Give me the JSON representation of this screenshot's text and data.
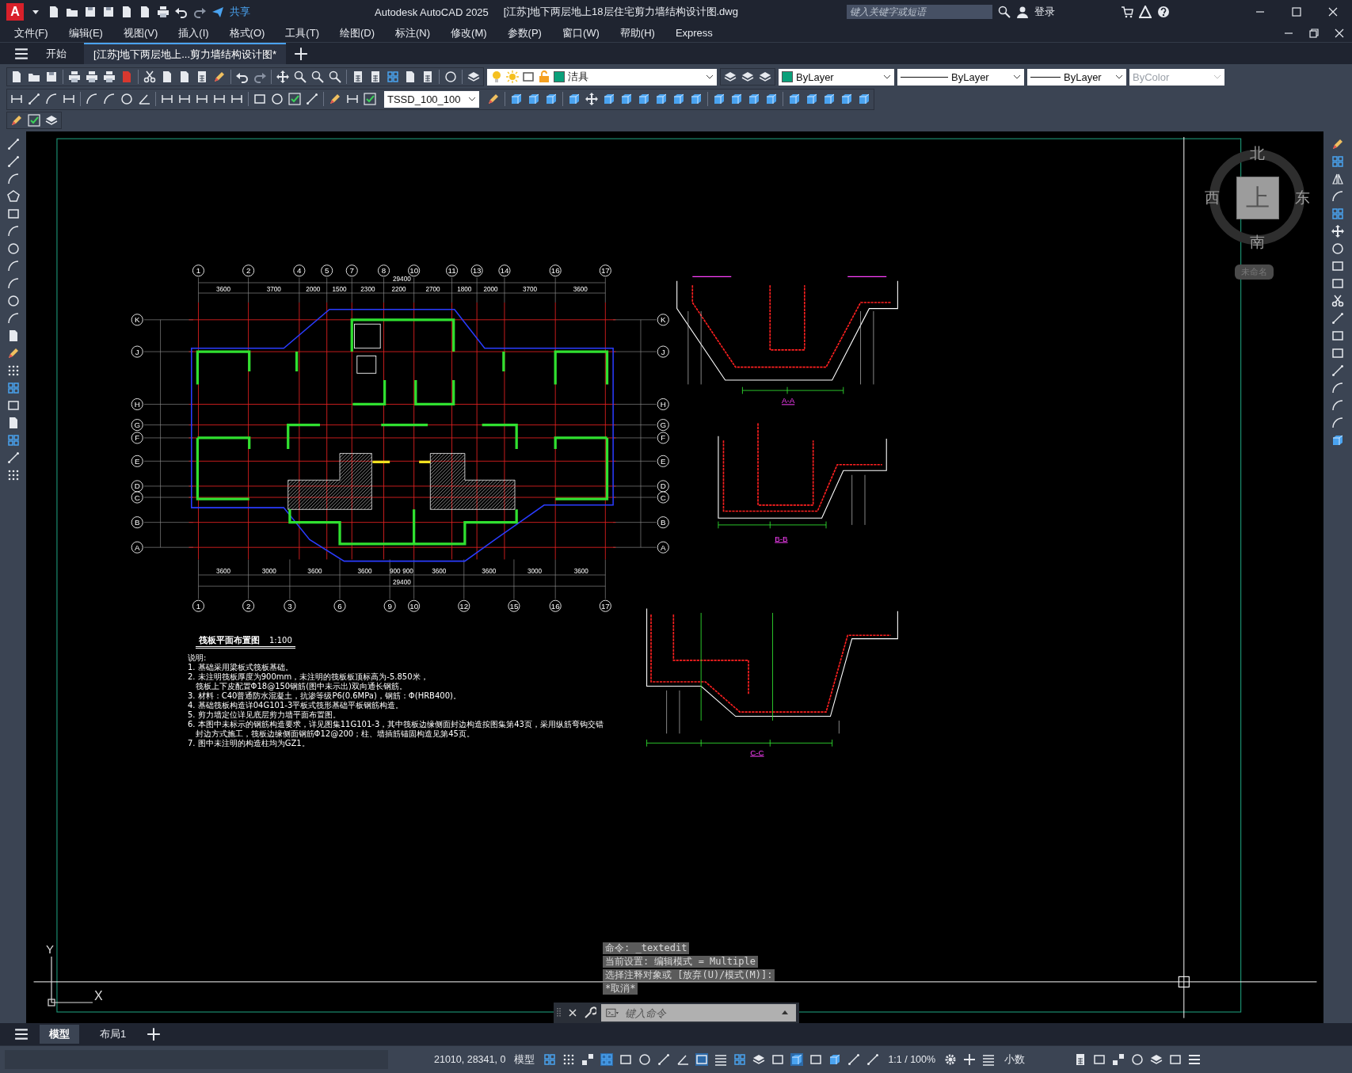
{
  "title_bar": {
    "logo": "A",
    "share": "共享",
    "app_title": "Autodesk AutoCAD 2025",
    "file_title": "[江苏]地下两层地上18层住宅剪力墙结构设计图.dwg",
    "search": {
      "placeholder": "键入关键字或短语"
    },
    "sign_in": "登录"
  },
  "menu": [
    "文件(F)",
    "编辑(E)",
    "视图(V)",
    "插入(I)",
    "格式(O)",
    "工具(T)",
    "绘图(D)",
    "标注(N)",
    "修改(M)",
    "参数(P)",
    "窗口(W)",
    "帮助(H)",
    "Express"
  ],
  "file_tabs": [
    {
      "label": "开始",
      "selected": false
    },
    {
      "label": "[江苏]地下两层地上...剪力墙结构设计图*",
      "selected": true
    }
  ],
  "properties_bar": {
    "layer": "洁具",
    "color_setting": "ByLayer",
    "linetype": "ByLayer",
    "lineweight": "ByLayer",
    "plot_style": {
      "label": "ByColor",
      "disabled": true
    }
  },
  "dim_style": "TSSD_100_100",
  "drawing": {
    "plan": {
      "top_axes": [
        "1",
        "2",
        "4",
        "5",
        "7",
        "8",
        "10",
        "11",
        "13",
        "14",
        "16",
        "17"
      ],
      "bottom_axes": [
        "1",
        "2",
        "3",
        "6",
        "9",
        "10",
        "12",
        "15",
        "16",
        "17"
      ],
      "left_axes": [
        "K",
        "J",
        "H",
        "G",
        "F",
        "E",
        "D",
        "C",
        "B",
        "A"
      ],
      "right_axes": [
        "K",
        "J",
        "H",
        "G",
        "F",
        "E",
        "D",
        "C",
        "B",
        "A"
      ],
      "top_dims": [
        "3600",
        "3700",
        "2000",
        "1500",
        "2300",
        "2200",
        "2700",
        "1800",
        "2000",
        "3700",
        "3600"
      ],
      "top_total": "29400",
      "bottom_dims": [
        "3600",
        "3000",
        "3600",
        "3600",
        "900",
        "900",
        "3600",
        "3600",
        "3000",
        "3600"
      ],
      "bottom_total": "29400"
    },
    "sections": [
      "A-A",
      "B-B",
      "C-C"
    ],
    "notes": {
      "title": "筏板平面布置图",
      "scale": "1:100",
      "heading": "说明:",
      "lines": [
        "1. 基础采用梁板式筏板基础。",
        "2. 未注明筏板厚度为900mm，未注明的筏板板顶标高为-5.850米，",
        "   筏板上下皮配置Φ18@150钢筋(图中未示出)双向通长钢筋。",
        "3. 材料：C40普通防水混凝土，抗渗等级P6(0.6MPa)，钢筋：Φ(HRB400)。",
        "4. 基础筏板构造详04G101-3平板式筏形基础平板钢筋构造。",
        "5. 剪力墙定位详见底层剪力墙平面布置图。",
        "6. 本图中未标示的钢筋构造要求，详见图集11G101-3，其中筏板边缘侧面封边构造按图集第43页，采用纵筋弯钩交错",
        "   封边方式施工，筏板边缘侧面钢筋Φ12@200；柱、墙插筋锚固构造见第45页。",
        "7. 图中未注明的构造柱均为GZ1。"
      ]
    }
  },
  "viewcube": {
    "north": "北",
    "west": "西",
    "east": "东",
    "south": "南",
    "top": "上",
    "view_name": "未命名"
  },
  "ucs": {
    "x": "X",
    "y": "Y"
  },
  "command_history": [
    "命令: _textedit",
    "当前设置: 编辑模式 = Multiple",
    "选择注释对象或 [放弃(U)/模式(M)]:",
    "*取消*"
  ],
  "command_line": {
    "placeholder": "键入命令"
  },
  "layout_tabs": [
    {
      "label": "模型",
      "selected": true
    },
    {
      "label": "布局1",
      "selected": false
    }
  ],
  "status_bar": {
    "coordinates": "21010, 28341, 0",
    "space": "模型",
    "scale": "1:1 / 100%",
    "units": "小数"
  }
}
